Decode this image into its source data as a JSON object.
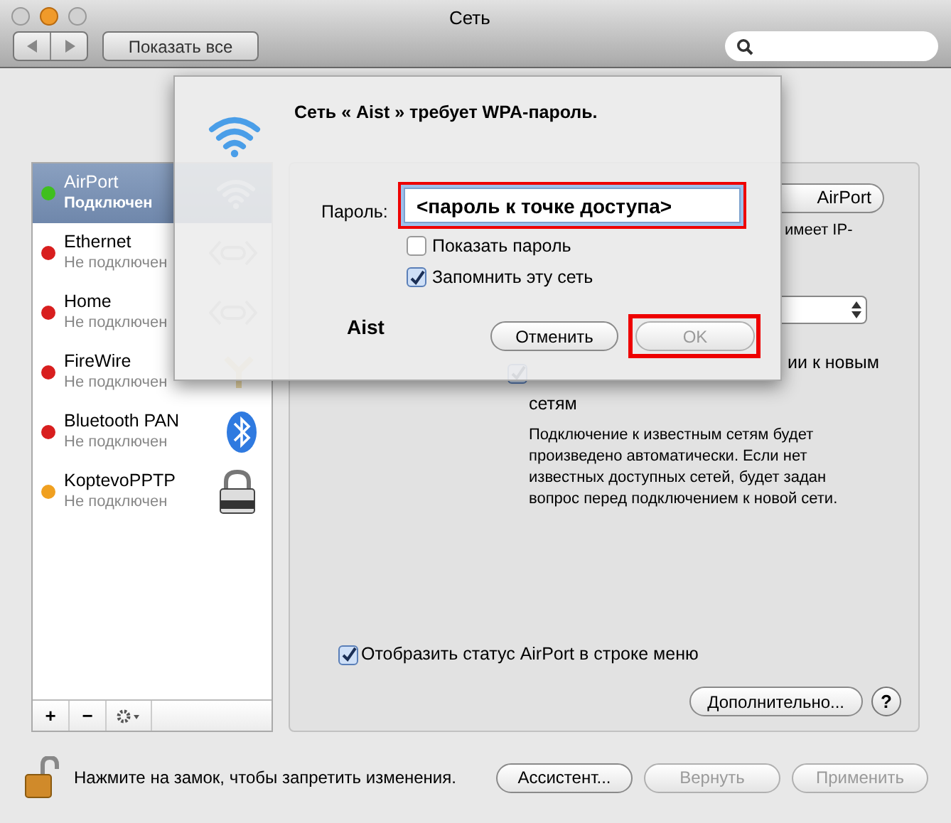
{
  "window": {
    "title": "Сеть",
    "show_all": "Показать все"
  },
  "services": [
    {
      "name": "AirPort",
      "status": "Подключен",
      "color": "#3fbf1f",
      "selected": true,
      "kind": "wifi"
    },
    {
      "name": "Ethernet",
      "status": "Не подключен",
      "color": "#d81e1e",
      "selected": false,
      "kind": "ethernet"
    },
    {
      "name": "Home",
      "status": "Не подключен",
      "color": "#d81e1e",
      "selected": false,
      "kind": "ethernet"
    },
    {
      "name": "FireWire",
      "status": "Не подключен",
      "color": "#d81e1e",
      "selected": false,
      "kind": "firewire"
    },
    {
      "name": "Bluetooth PAN",
      "status": "Не подключен",
      "color": "#d81e1e",
      "selected": false,
      "kind": "bluetooth"
    },
    {
      "name": "KoptevoPPTP",
      "status": "Не подключен",
      "color": "#f0a020",
      "selected": false,
      "kind": "vpn"
    }
  ],
  "list_buttons": [
    "+",
    "−"
  ],
  "panel": {
    "power_button": "AirPort",
    "status_text": "имеет IP-",
    "ask": {
      "label_line_1": "ии к новым",
      "label_line_2": "сетям",
      "checked": true
    },
    "ask_note": "Подключение к известным сетям будет произведено автоматически. Если нет известных доступных сетей, будет задан вопрос перед подключением к новой сети.",
    "menu_status": {
      "label": "Отобразить статус AirPort в строке меню",
      "checked": true
    },
    "advanced": "Дополнительно...",
    "help": "?"
  },
  "footer": {
    "lock_text": "Нажмите на замок, чтобы запретить изменения.",
    "buttons": [
      {
        "label": "Ассистент...",
        "disabled": false
      },
      {
        "label": "Вернуть",
        "disabled": true
      },
      {
        "label": "Применить",
        "disabled": true
      }
    ]
  },
  "sheet": {
    "title": "Сеть « Aist » требует WPA-пароль.",
    "password_label": "Пароль:",
    "password_value": "<пароль к точке доступа>",
    "password_highlighted": true,
    "show_password": {
      "label": "Показать пароль",
      "checked": false
    },
    "remember": {
      "label": "Запомнить эту сеть",
      "checked": true
    },
    "network": "Aist",
    "cancel": "Отменить",
    "ok": {
      "label": "OK",
      "disabled": true,
      "highlighted": true
    }
  }
}
